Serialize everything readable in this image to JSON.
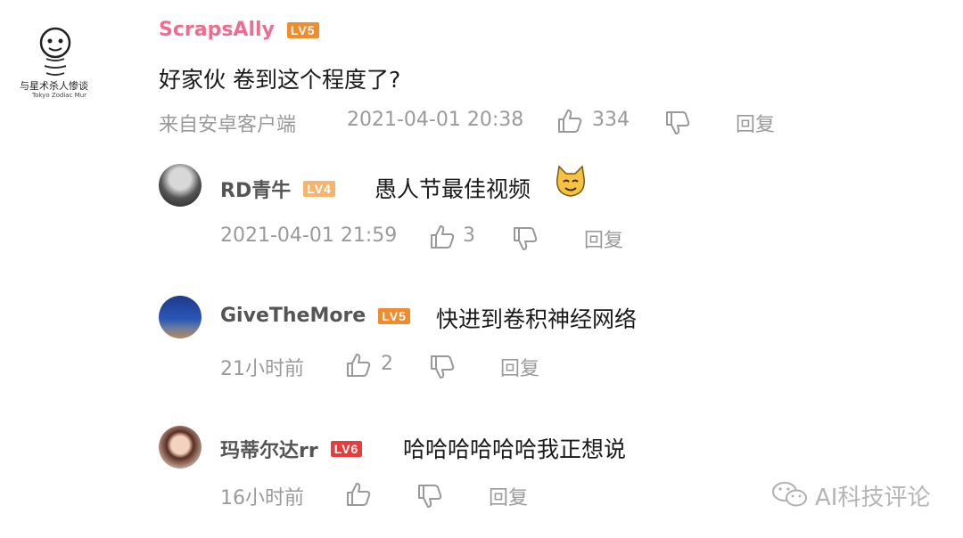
{
  "comment": {
    "user": "ScrapsAlly",
    "level": "LV5",
    "avatar_caption": "与星术杀人惨谈",
    "avatar_caption_en": "Tokyo Zodiac Mur",
    "text": "好家伙 卷到这个程度了?",
    "source": "来自安卓客户端",
    "time": "2021-04-01 20:38",
    "likes": "334",
    "reply_label": "回复"
  },
  "replies": [
    {
      "user": "RD青牛",
      "level": "LV4",
      "text": "愚人节最佳视频",
      "emoji": "cat-emoji",
      "time": "2021-04-01 21:59",
      "likes": "3",
      "reply_label": "回复"
    },
    {
      "user": "GiveTheMore",
      "level": "LV5",
      "text": "快进到卷积神经网络",
      "time": "21小时前",
      "likes": "2",
      "reply_label": "回复"
    },
    {
      "user": "玛蒂尔达rr",
      "level": "LV6",
      "text": "哈哈哈哈哈哈我正想说",
      "time": "16小时前",
      "likes": "",
      "reply_label": "回复"
    }
  ],
  "watermark": "AI科技评论",
  "colors": {
    "username_main": "#ee6c8f",
    "lv5": "#f08b2e",
    "lv4": "#f7b46c",
    "lv6": "#e83b3b",
    "meta": "#9a9a9a"
  }
}
